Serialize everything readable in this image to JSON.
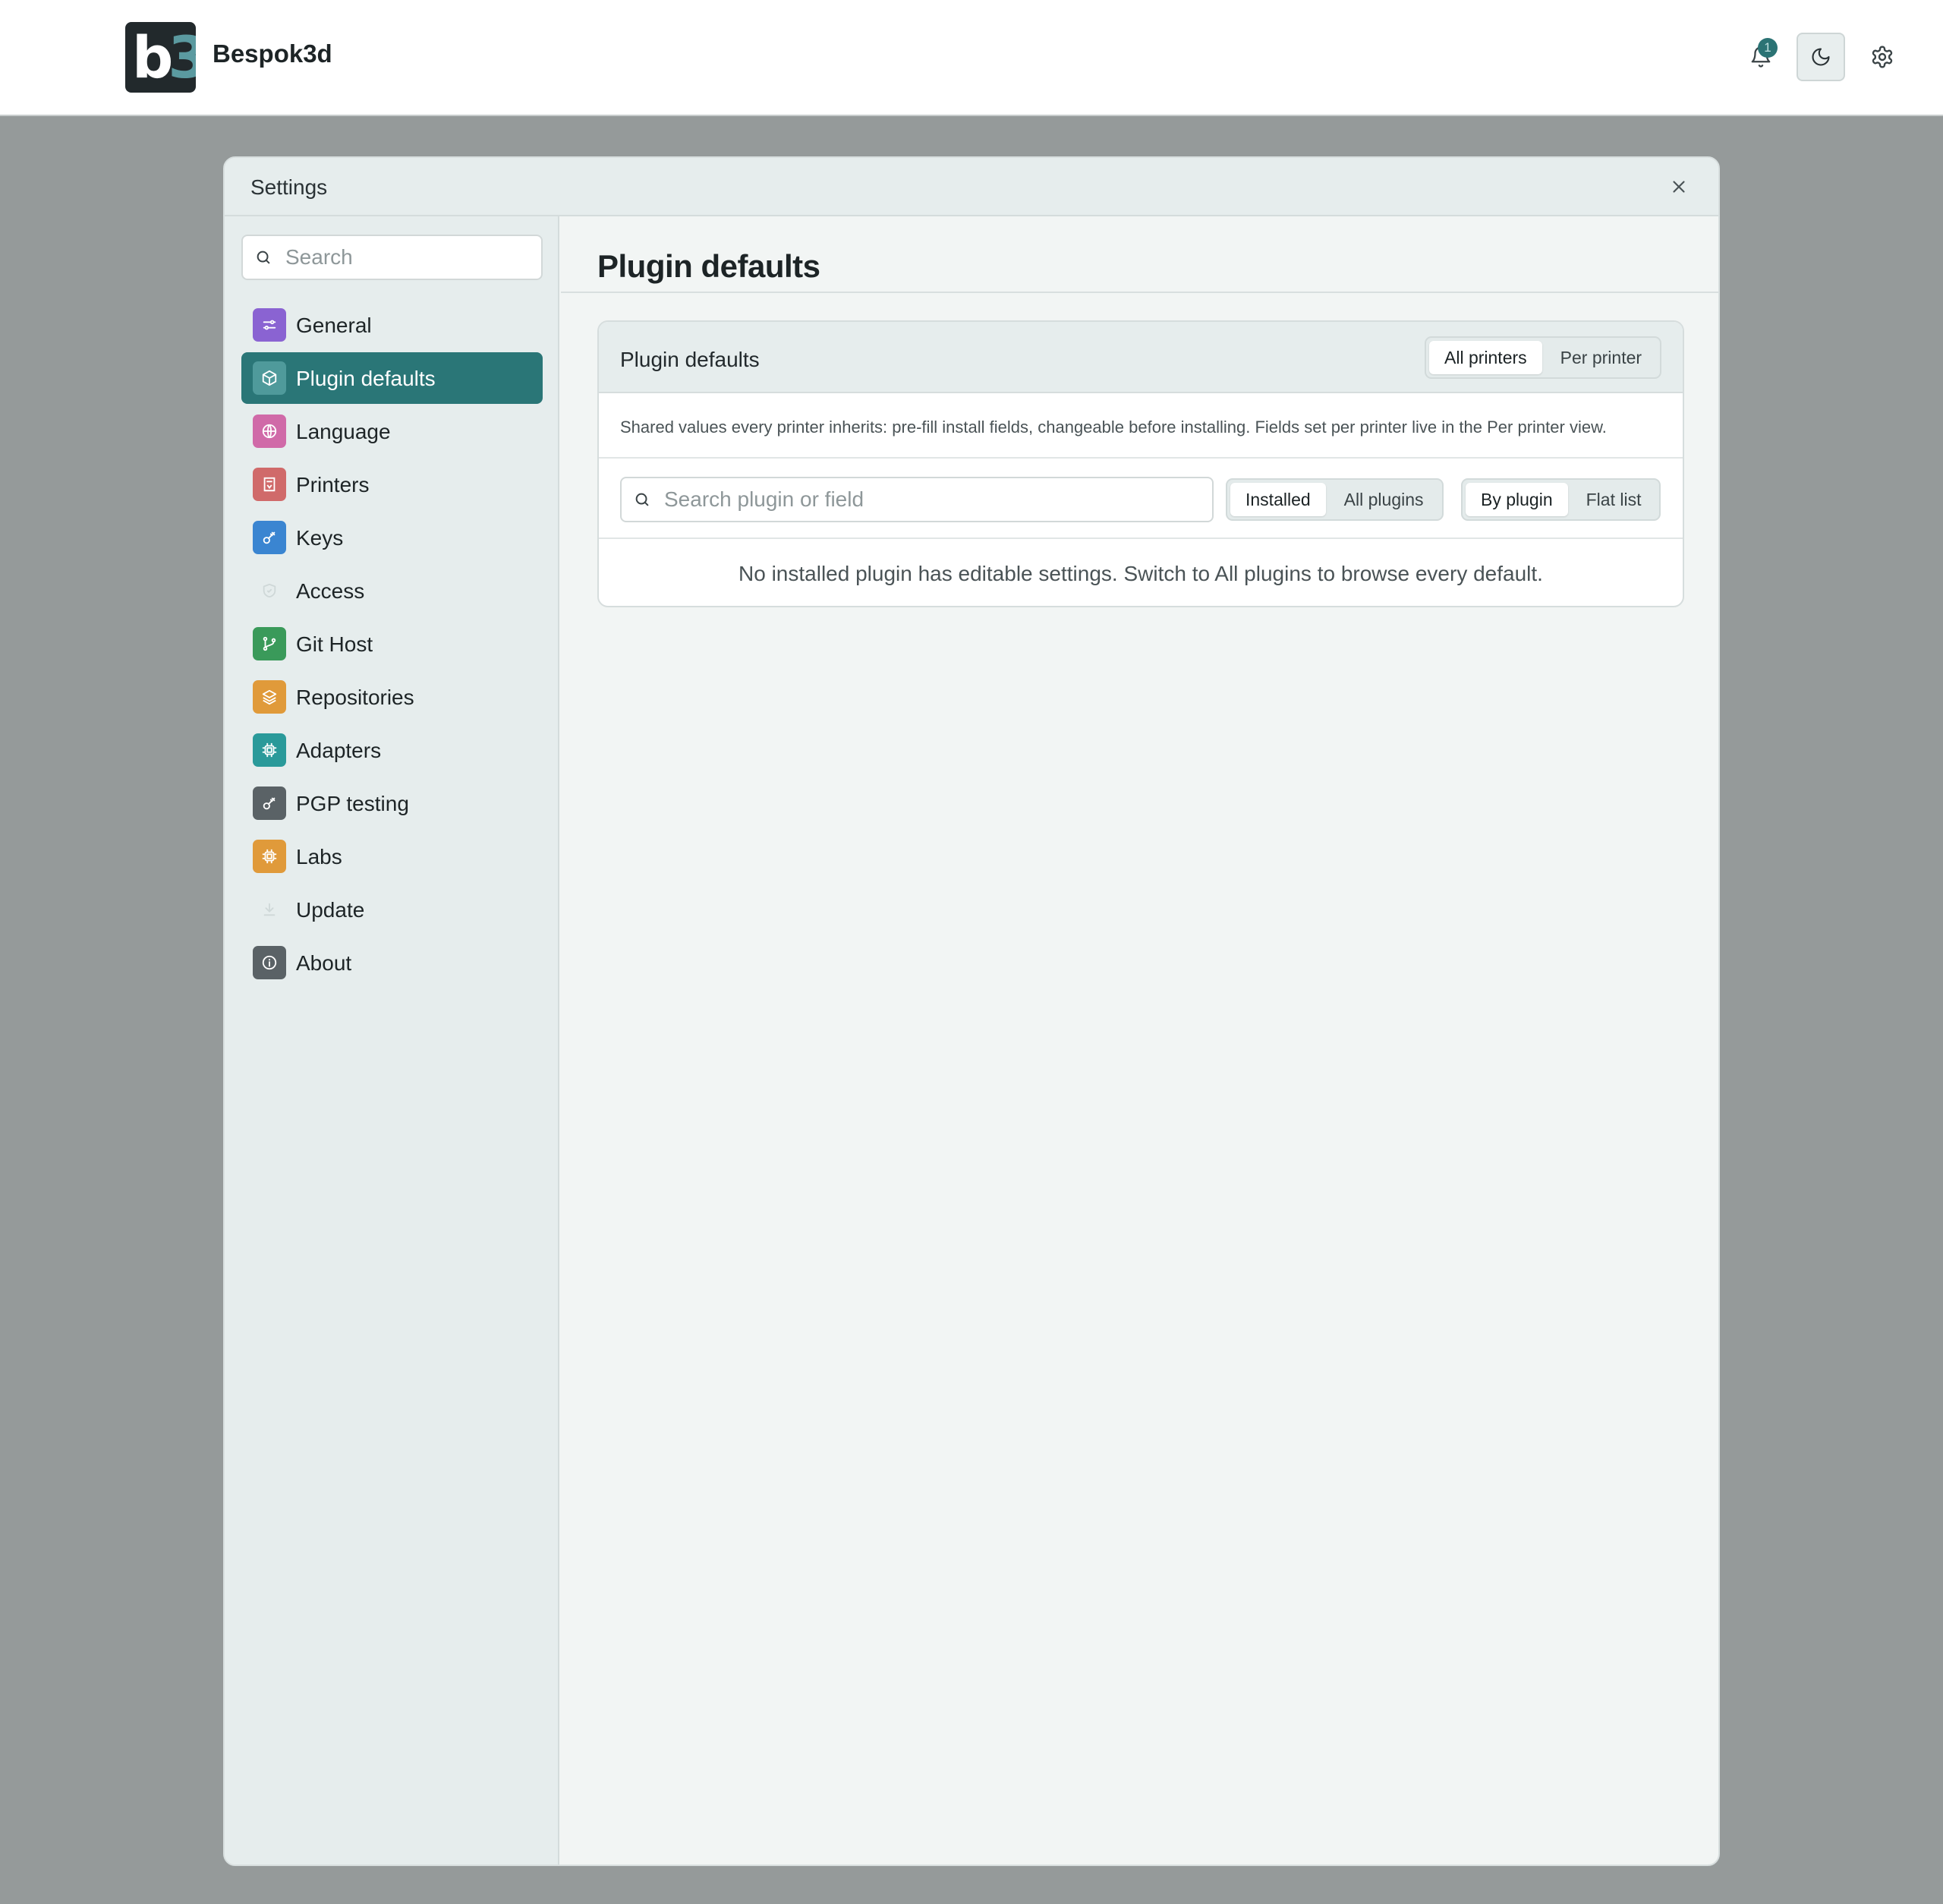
{
  "app": {
    "logo_text": "b3",
    "name": "Bespok3d",
    "notification_count": "1"
  },
  "modal": {
    "title": "Settings"
  },
  "sidebar": {
    "search_placeholder": "Search",
    "items": [
      {
        "label": "General",
        "icon": "sliders-icon",
        "color": "#8a63d2"
      },
      {
        "label": "Plugin defaults",
        "icon": "box-icon",
        "color": "#4f9a9b",
        "active": true
      },
      {
        "label": "Language",
        "icon": "globe-icon",
        "color": "#d06aa8"
      },
      {
        "label": "Printers",
        "icon": "printer-icon",
        "color": "#d06a6a"
      },
      {
        "label": "Keys",
        "icon": "key-icon",
        "color": "#3a85d1"
      },
      {
        "label": "Access",
        "icon": "shield-icon",
        "color": "transparent"
      },
      {
        "label": "Git Host",
        "icon": "git-branch-icon",
        "color": "#3a9a5a"
      },
      {
        "label": "Repositories",
        "icon": "layers-icon",
        "color": "#e09a3a"
      },
      {
        "label": "Adapters",
        "icon": "chip-icon",
        "color": "#2a9a9a"
      },
      {
        "label": "PGP testing",
        "icon": "key-icon",
        "color": "#5a6266"
      },
      {
        "label": "Labs",
        "icon": "chip-icon",
        "color": "#e09a3a"
      },
      {
        "label": "Update",
        "icon": "download-icon",
        "color": "transparent"
      },
      {
        "label": "About",
        "icon": "info-icon",
        "color": "#5a6266"
      }
    ]
  },
  "main": {
    "page_title": "Plugin defaults",
    "card": {
      "title": "Plugin defaults",
      "scope_tabs": [
        "All printers",
        "Per printer"
      ],
      "scope_selected": "All printers",
      "description": "Shared values every printer inherits: pre-fill install fields, changeable before installing. Fields set per printer live in the Per printer view.",
      "search_placeholder": "Search plugin or field",
      "filter_tabs": [
        "Installed",
        "All plugins"
      ],
      "filter_selected": "Installed",
      "view_tabs": [
        "By plugin",
        "Flat list"
      ],
      "view_selected": "By plugin",
      "empty_message": "No installed plugin has editable settings. Switch to All plugins to browse every default."
    }
  }
}
